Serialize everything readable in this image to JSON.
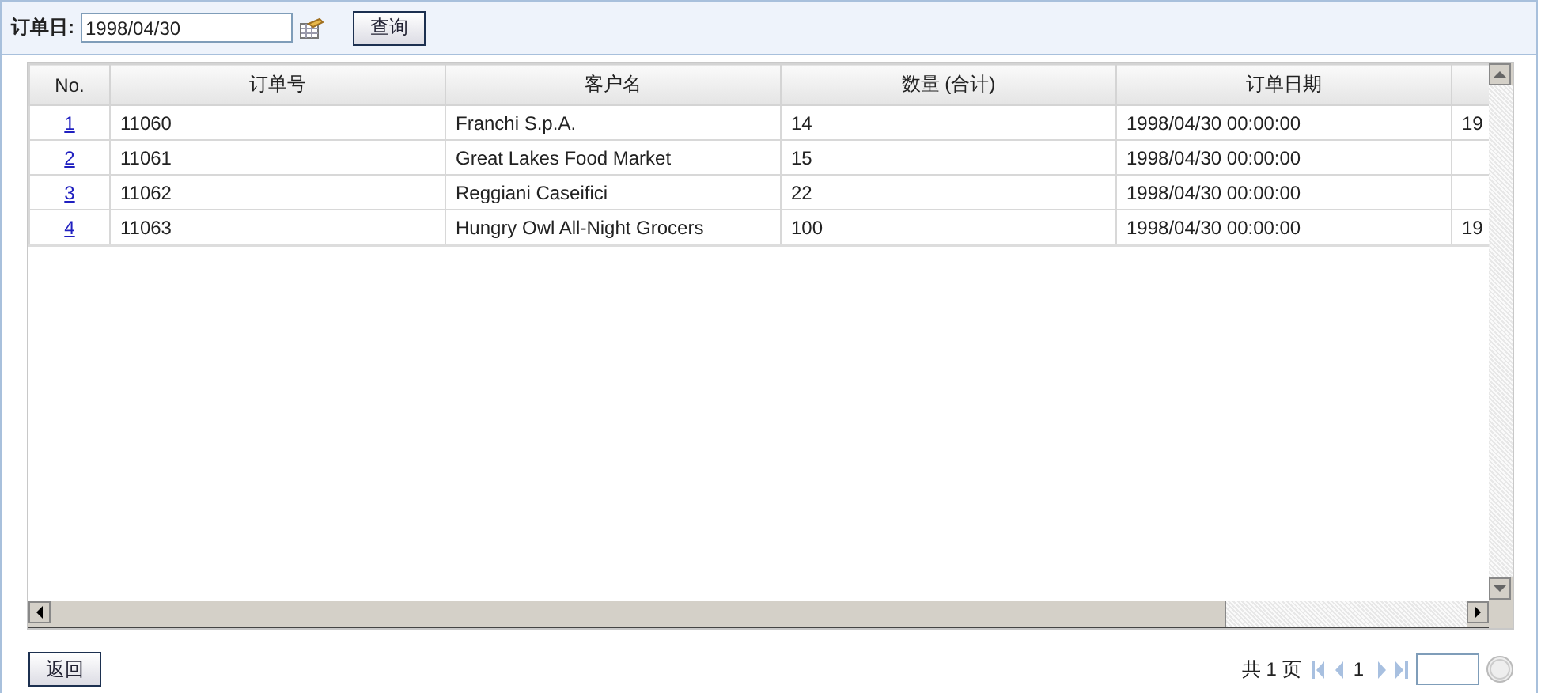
{
  "filter": {
    "label": "订单日:",
    "value": "1998/04/30",
    "button": "查询"
  },
  "table": {
    "columns": [
      "No.",
      "订单号",
      "客户名",
      "数量 (合计)",
      "订单日期"
    ],
    "rows": [
      {
        "no": "1",
        "order": "11060",
        "customer": "Franchi S.p.A.",
        "quantity": "14",
        "date": "1998/04/30 00:00:00",
        "column_6": "19"
      },
      {
        "no": "2",
        "order": "11061",
        "customer": "Great Lakes Food Market",
        "quantity": "15",
        "date": "1998/04/30 00:00:00"
      },
      {
        "no": "3",
        "order": "11062",
        "customer": "Reggiani Caseifici",
        "quantity": "22",
        "date": "1998/04/30 00:00:00"
      },
      {
        "no": "4",
        "order": "11063",
        "customer": "Hungry Owl All-Night Grocers",
        "quantity": "100",
        "date": "1998/04/30 00:00:00",
        "column_6": "19"
      }
    ]
  },
  "footer": {
    "back_button": "返回",
    "pages": "共 1 页",
    "current_page": "1"
  }
}
